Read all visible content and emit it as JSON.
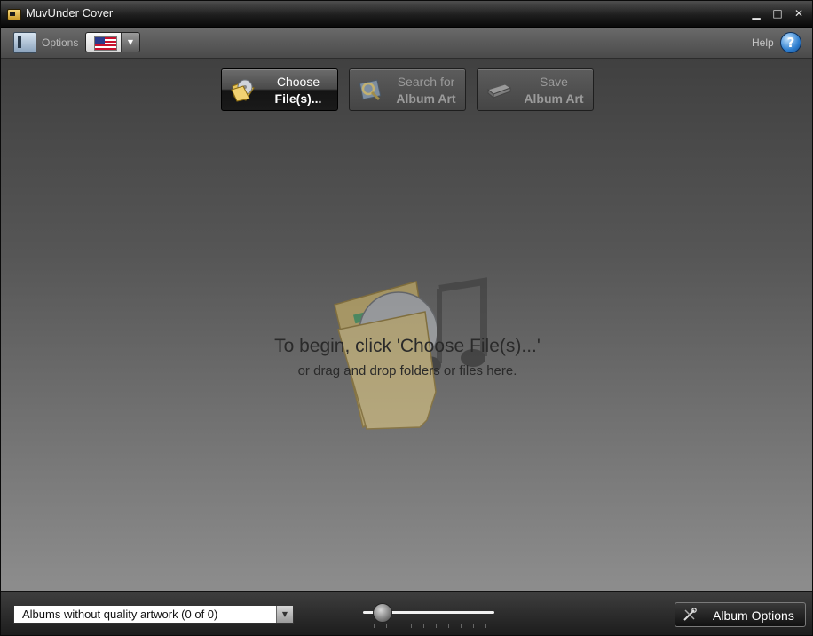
{
  "window": {
    "title": "MuvUnder Cover",
    "controls": {
      "minimize": "▁",
      "maximize": "□",
      "close": "✕"
    }
  },
  "toolbar": {
    "options_label": "Options",
    "language_selected": "en-US",
    "help_label": "Help",
    "help_icon_glyph": "?"
  },
  "actions": {
    "choose": {
      "line1": "Choose",
      "line2": "File(s)...",
      "icon": "folder-disc-icon",
      "state": "active"
    },
    "search": {
      "line1": "Search for",
      "line2": "Album Art",
      "icon": "search-album-icon",
      "state": "disabled"
    },
    "save": {
      "line1": "Save",
      "line2": "Album Art",
      "icon": "save-drive-icon",
      "state": "disabled"
    }
  },
  "drop_zone": {
    "title": "To begin, click 'Choose File(s)...'",
    "subtitle": "or drag and drop folders or files here."
  },
  "bottombar": {
    "filter_selected": "Albums without quality artwork (0 of 0)",
    "zoom_level": 0.15,
    "album_options_label": "Album Options"
  },
  "colors": {
    "accent_active": "#141414",
    "background_top": "#3a3a3a",
    "background_bottom": "#8c8c8c"
  }
}
